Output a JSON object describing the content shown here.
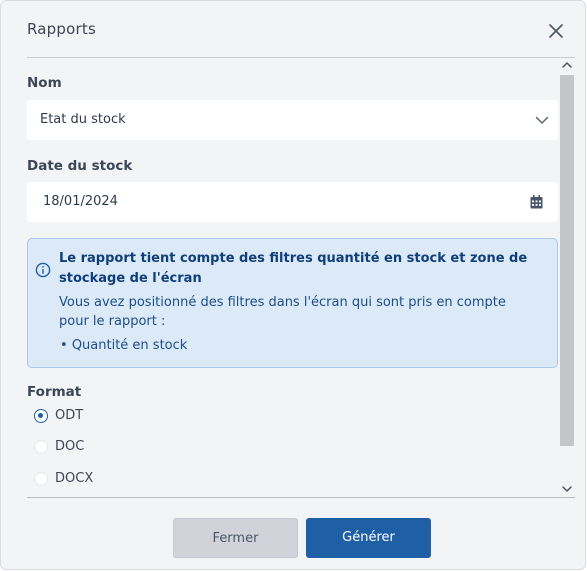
{
  "dialog": {
    "title": "Rapports",
    "close_icon": "close-icon"
  },
  "form": {
    "nom": {
      "label": "Nom",
      "value": "Etat du stock",
      "icon": "chevron-down-icon"
    },
    "date": {
      "label": "Date du stock",
      "value": "18/01/2024",
      "icon": "calendar-icon"
    },
    "info": {
      "icon": "info-icon",
      "title": "Le rapport tient compte des filtres quantité en stock et zone de stockage de l'écran",
      "text": "Vous avez positionné des filtres dans l'écran qui sont pris en compte pour le rapport :",
      "bullets": [
        "Quantité en stock"
      ]
    },
    "format": {
      "label": "Format",
      "options": [
        {
          "label": "ODT",
          "checked": true
        },
        {
          "label": "DOC",
          "checked": false
        },
        {
          "label": "DOCX",
          "checked": false
        }
      ]
    }
  },
  "footer": {
    "close_label": "Fermer",
    "generate_label": "Générer"
  },
  "colors": {
    "primary": "#1f5fa6",
    "info_bg": "#dce9f7",
    "info_border": "#a9c7e8",
    "dialog_bg": "#f3f4f6"
  }
}
